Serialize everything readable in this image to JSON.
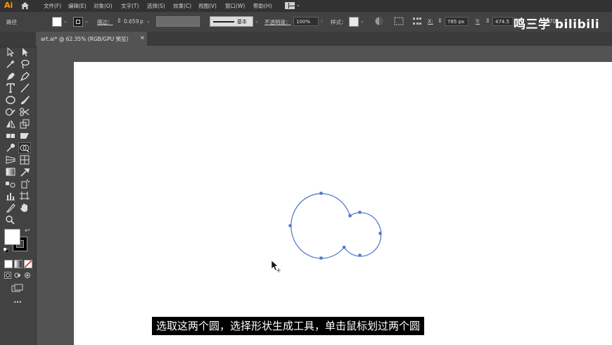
{
  "app": {
    "logo": "Ai"
  },
  "menu": [
    "文件(F)",
    "编辑(E)",
    "对象(O)",
    "文字(T)",
    "选择(S)",
    "效果(C)",
    "视图(V)",
    "窗口(W)",
    "帮助(H)"
  ],
  "control_bar": {
    "selection_label": "路径",
    "stroke_label": "描边：",
    "stroke_value": "0.659",
    "stroke_unit": "p",
    "brush_label": "基本",
    "opacity_label": "不透明度：",
    "opacity_value": "100%",
    "style_label": "样式：",
    "x_label": "X:",
    "x_value": "785 px",
    "y_label": "Y:",
    "y_value": "474.5",
    "w_value": "270"
  },
  "document_tab": {
    "title": "art.ai* @ 62.35% (RGB/GPU 预览)",
    "close": "×"
  },
  "watermark": "鸣三学  bilibili",
  "subtitle": "选取这两个圆，选择形状生成工具，单击鼠标划过两个圆",
  "toolbar": {
    "more": "•••"
  },
  "colors": {
    "path_stroke": "#4a72c8",
    "ui_dark": "#323232",
    "panel": "#424242",
    "canvas": "#535353"
  }
}
